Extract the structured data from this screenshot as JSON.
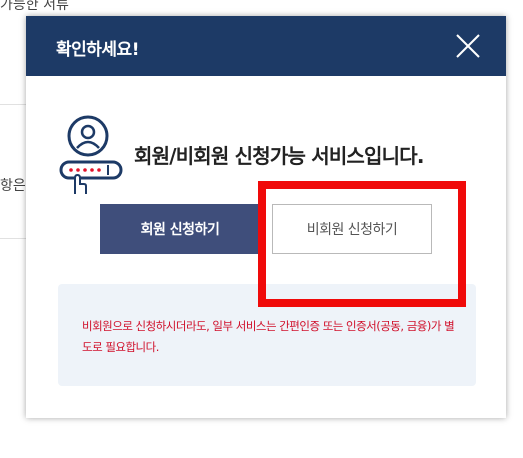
{
  "background": {
    "top_text": "가능한 서류",
    "side_text": "항은"
  },
  "modal": {
    "title": "확인하세요!",
    "message": "회원/비회원 신청가능 서비스입니다.",
    "buttons": {
      "member_label": "회원 신청하기",
      "nonmember_label": "비회원 신청하기"
    },
    "notice": "비회원으로 신청하시더라도, 일부 서비스는 간편인증 또는 인증서(공동, 금융)가 별도로 필요합니다."
  },
  "colors": {
    "header_bg": "#1d3a66",
    "member_button_bg": "#3f4e7b",
    "notice_text": "#d0102b",
    "notice_bg": "#eef3f9",
    "highlight_box": "#f00a0a"
  },
  "icons": {
    "close": "close-icon",
    "person": "person-login-icon"
  }
}
